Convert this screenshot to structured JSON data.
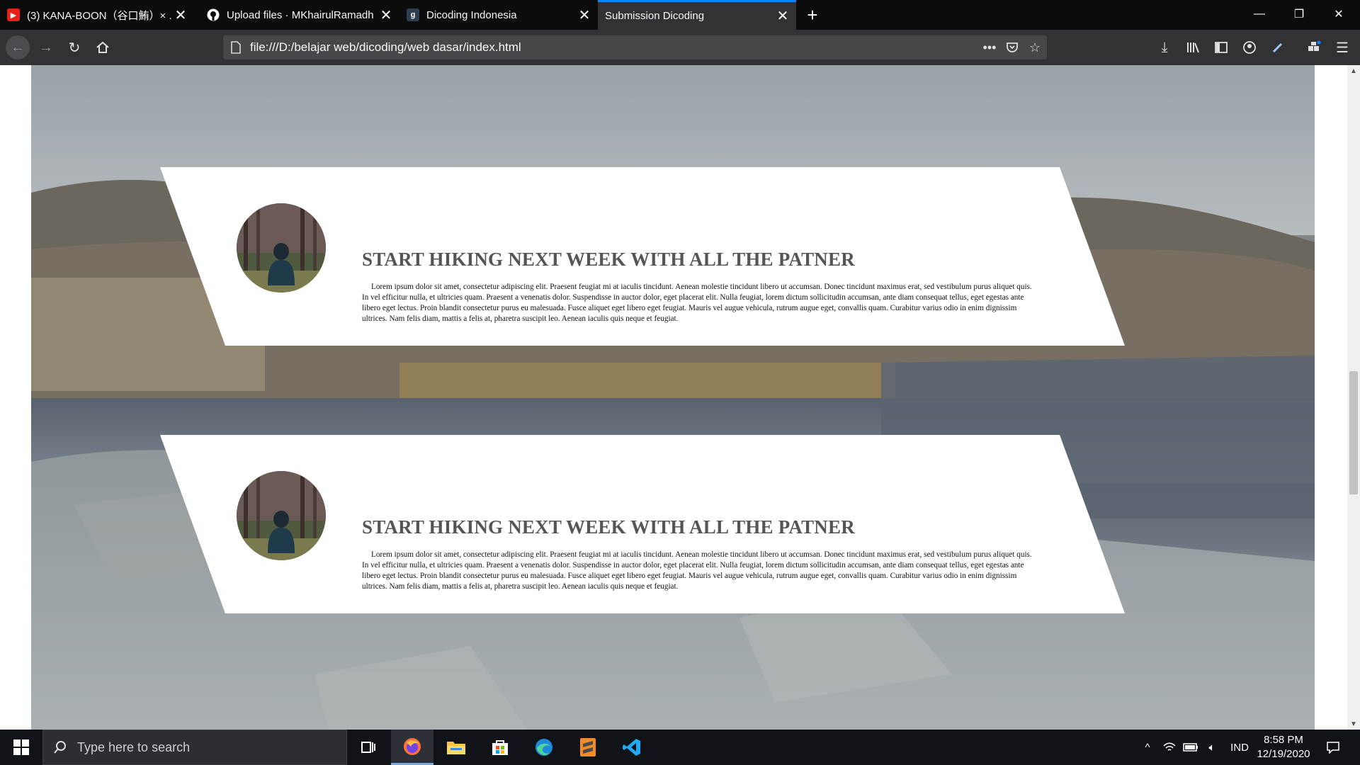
{
  "browser": {
    "tabs": [
      {
        "title": "(3) KANA-BOON（谷口鮪）× ...",
        "favicon": "youtube-icon",
        "active": false
      },
      {
        "title": "Upload files · MKhairulRamadh",
        "favicon": "github-icon",
        "active": false
      },
      {
        "title": "Dicoding Indonesia",
        "favicon": "dicoding-icon",
        "active": false
      },
      {
        "title": "Submission Dicoding",
        "favicon": "",
        "active": true
      }
    ],
    "url": "file:///D:/belajar web/dicoding/web dasar/index.html",
    "accent_color": "#0a84ff"
  },
  "page": {
    "cards": [
      {
        "title": "START HIKING NEXT WEEK WITH ALL THE PATNER",
        "body": "Lorem ipsum dolor sit amet, consectetur adipiscing elit. Praesent feugiat mi at iaculis tincidunt. Aenean molestie tincidunt libero ut accumsan. Donec tincidunt maximus erat, sed vestibulum purus aliquet quis. In vel efficitur nulla, et ultricies quam. Praesent a venenatis dolor. Suspendisse in auctor dolor, eget placerat elit. Nulla feugiat, lorem dictum sollicitudin accumsan, ante diam consequat tellus, eget egestas ante libero eget lectus. Proin blandit consectetur purus eu malesuada. Fusce aliquet eget libero eget feugiat. Mauris vel augue vehicula, rutrum augue eget, convallis quam. Curabitur varius odio in enim dignissim ultrices. Nam felis diam, mattis a felis at, pharetra suscipit leo. Aenean iaculis quis neque et feugiat."
      },
      {
        "title": "START HIKING NEXT WEEK WITH ALL THE PATNER",
        "body": "Lorem ipsum dolor sit amet, consectetur adipiscing elit. Praesent feugiat mi at iaculis tincidunt. Aenean molestie tincidunt libero ut accumsan. Donec tincidunt maximus erat, sed vestibulum purus aliquet quis. In vel efficitur nulla, et ultricies quam. Praesent a venenatis dolor. Suspendisse in auctor dolor, eget placerat elit. Nulla feugiat, lorem dictum sollicitudin accumsan, ante diam consequat tellus, eget egestas ante libero eget lectus. Proin blandit consectetur purus eu malesuada. Fusce aliquet eget libero eget feugiat. Mauris vel augue vehicula, rutrum augue eget, convallis quam. Curabitur varius odio in enim dignissim ultrices. Nam felis diam, mattis a felis at, pharetra suscipit leo. Aenean iaculis quis neque et feugiat."
      }
    ]
  },
  "taskbar": {
    "search_placeholder": "Type here to search",
    "apps": [
      "task-view-icon",
      "firefox-icon",
      "file-explorer-icon",
      "store-icon",
      "edge-icon",
      "sublime-text-icon",
      "vscode-icon"
    ],
    "language": "IND",
    "time": "8:58 PM",
    "date": "12/19/2020"
  }
}
